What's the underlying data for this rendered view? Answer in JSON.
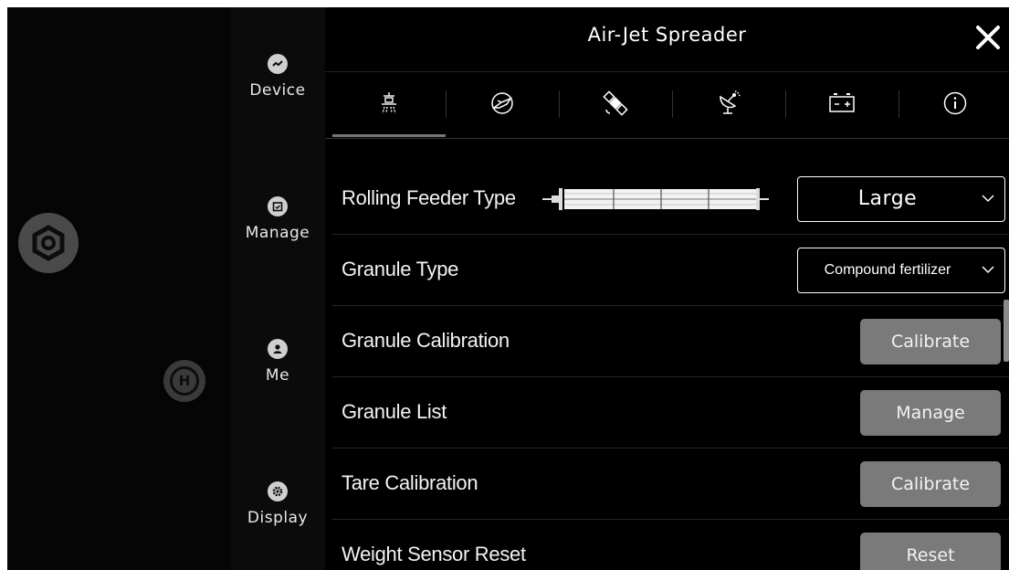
{
  "window": {
    "title": "Air-Jet Spreader"
  },
  "sidebar": {
    "items": [
      {
        "label": "Device",
        "icon": "device-icon"
      },
      {
        "label": "Manage",
        "icon": "manage-icon"
      },
      {
        "label": "Me",
        "icon": "user-icon"
      },
      {
        "label": "Display",
        "icon": "display-icon"
      }
    ]
  },
  "tabs": [
    {
      "icon": "spreader-icon",
      "active": true
    },
    {
      "icon": "aircraft-icon"
    },
    {
      "icon": "satellite-icon"
    },
    {
      "icon": "radar-icon"
    },
    {
      "icon": "battery-icon"
    },
    {
      "icon": "info-icon"
    }
  ],
  "settings": {
    "rolling_feeder": {
      "label": "Rolling Feeder Type",
      "value": "Large"
    },
    "granule_type": {
      "label": "Granule Type",
      "value": "Compound fertilizer"
    },
    "granule_calibration": {
      "label": "Granule Calibration",
      "button": "Calibrate"
    },
    "granule_list": {
      "label": "Granule List",
      "button": "Manage"
    },
    "tare_calibration": {
      "label": "Tare Calibration",
      "button": "Calibrate"
    },
    "weight_sensor_reset": {
      "label": "Weight Sensor Reset",
      "button": "Reset"
    }
  },
  "colors": {
    "background": "#000000",
    "button": "#7a7a7a",
    "text": "#ffffff"
  }
}
